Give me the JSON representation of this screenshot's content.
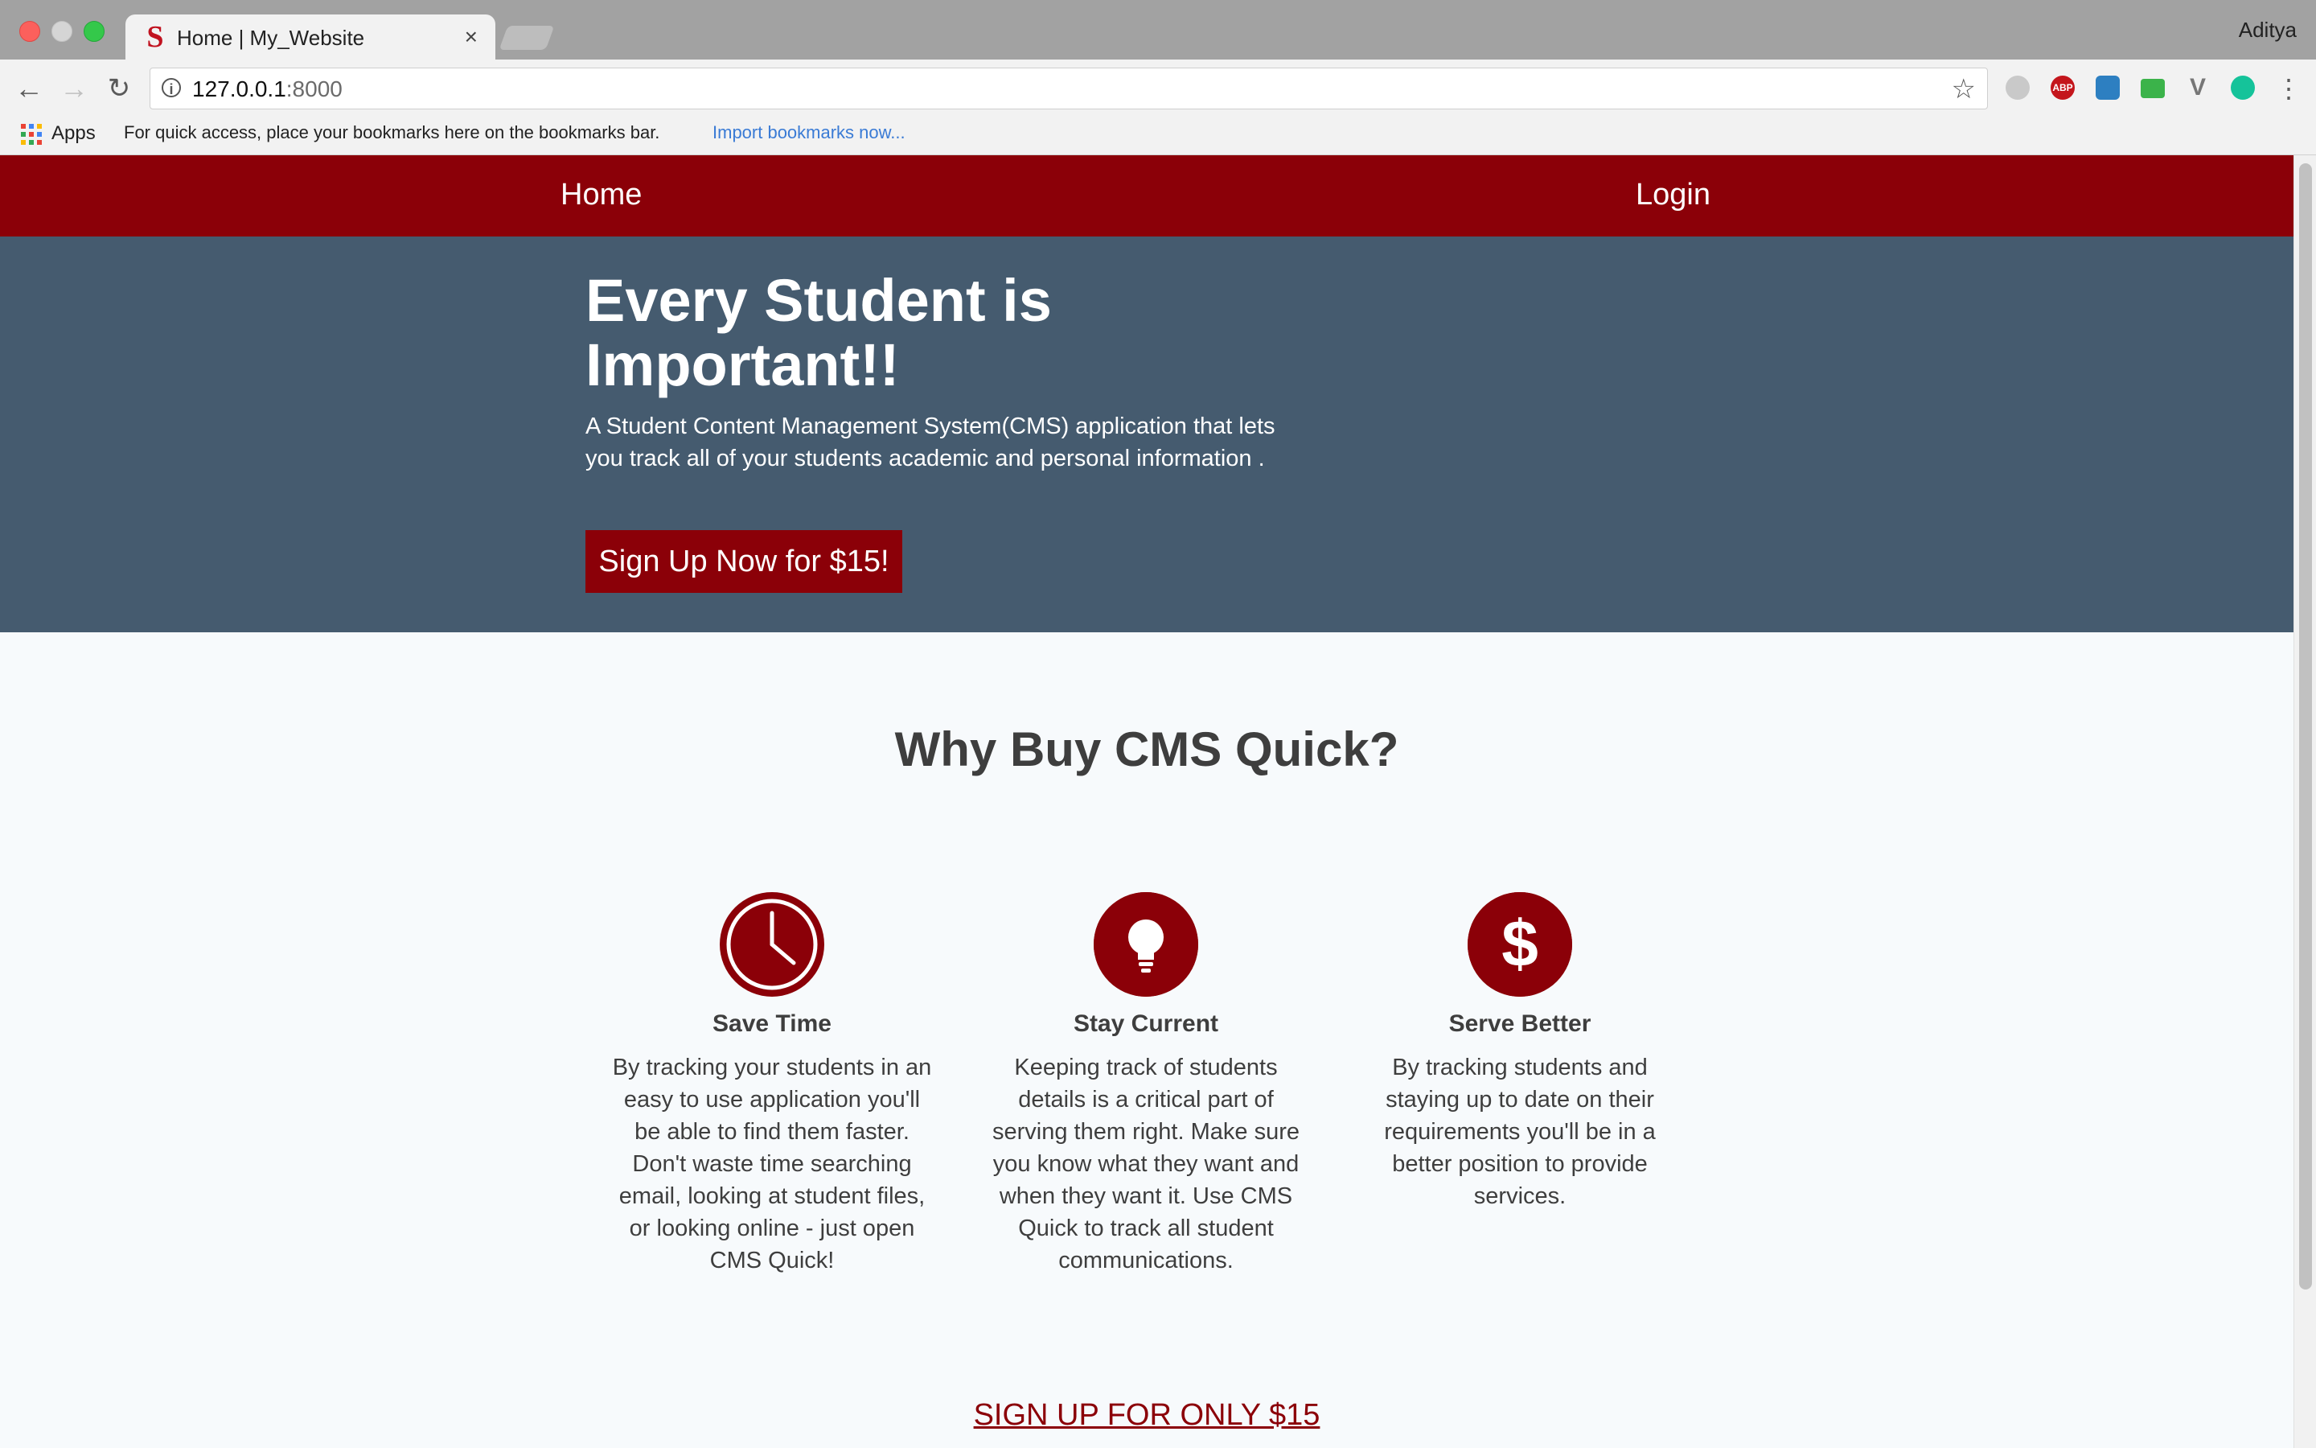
{
  "browser": {
    "tab_title": "Home | My_Website",
    "tab_close": "×",
    "profile_name": "Aditya",
    "url_host": "127.0.0.1",
    "url_port": ":8000",
    "apps_label": "Apps",
    "bookmarks_hint": "For quick access, place your bookmarks here on the bookmarks bar.",
    "bookmarks_import": "Import bookmarks now...",
    "extensions": [
      "skype-icon",
      "adblock-plus-icon",
      "compass-icon",
      "tv-icon",
      "vimeo-icon",
      "grammarly-icon"
    ]
  },
  "navbar": {
    "home": "Home",
    "login": "Login"
  },
  "hero": {
    "title": "Every Student is Important!!",
    "subtitle": "A Student Content Management System(CMS) application that lets you track all of your students academic and personal information .",
    "button": "Sign Up Now for $15!"
  },
  "why": {
    "title": "Why Buy CMS Quick?",
    "features": [
      {
        "icon": "clock-icon",
        "heading": "Save Time",
        "text": "By tracking your students in an easy to use application you'll be able to find them faster. Don't waste time searching email, looking at student files, or looking online - just open CMS Quick!"
      },
      {
        "icon": "lightbulb-icon",
        "heading": "Stay Current",
        "text": "Keeping track of students details is a critical part of serving them right. Make sure you know what they want and when they want it. Use CMS Quick to track all student communications."
      },
      {
        "icon": "dollar-icon",
        "heading": "Serve Better",
        "text": "By tracking students and staying up to date on their requirements you'll be in a better position to provide services."
      }
    ]
  },
  "cta": "SIGN UP FOR ONLY $15",
  "colors": {
    "brand_red": "#8b0008",
    "hero_bg": "#455b6f",
    "page_bg": "#f7fafc"
  }
}
